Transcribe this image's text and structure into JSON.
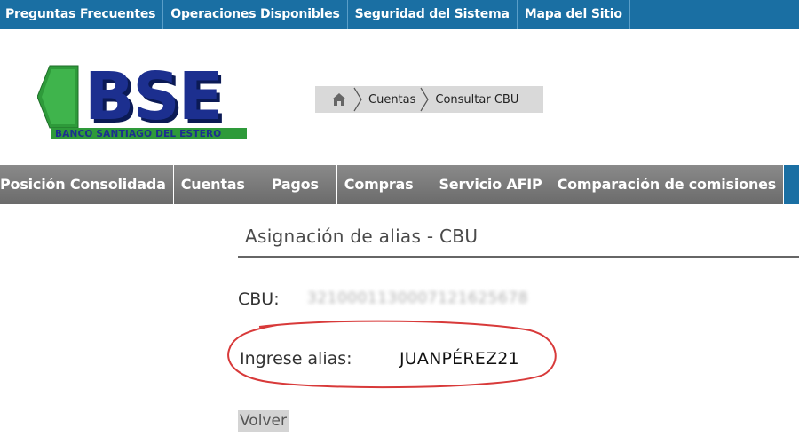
{
  "top_links": [
    {
      "label": "Preguntas Frecuentes"
    },
    {
      "label": "Operaciones Disponibles"
    },
    {
      "label": "Seguridad del Sistema"
    },
    {
      "label": "Mapa del Sitio"
    }
  ],
  "logo": {
    "title": "BSE",
    "subtitle": "BANCO SANTIAGO DEL ESTERO"
  },
  "breadcrumb": {
    "items": [
      {
        "label": "Cuentas"
      },
      {
        "label": "Consultar CBU"
      }
    ]
  },
  "main_nav": [
    {
      "label": "Posición Consolidada"
    },
    {
      "label": "Cuentas"
    },
    {
      "label": "Pagos"
    },
    {
      "label": "Compras"
    },
    {
      "label": "Servicio AFIP"
    },
    {
      "label": "Comparación de comisiones"
    }
  ],
  "content": {
    "title": "Asignación de alias - CBU",
    "cbu_label": "CBU:",
    "cbu_value": "3210001130007121625678",
    "alias_label": "Ingrese alias:",
    "alias_value": "JUANPÉREZ21",
    "back_label": "Volver"
  },
  "colors": {
    "top_bar": "#1a6fa3",
    "nav_gray": "#7a7a7a",
    "logo_green": "#2e9a3a",
    "logo_blue": "#1c2f8f",
    "highlight_red": "#d83a3a"
  }
}
